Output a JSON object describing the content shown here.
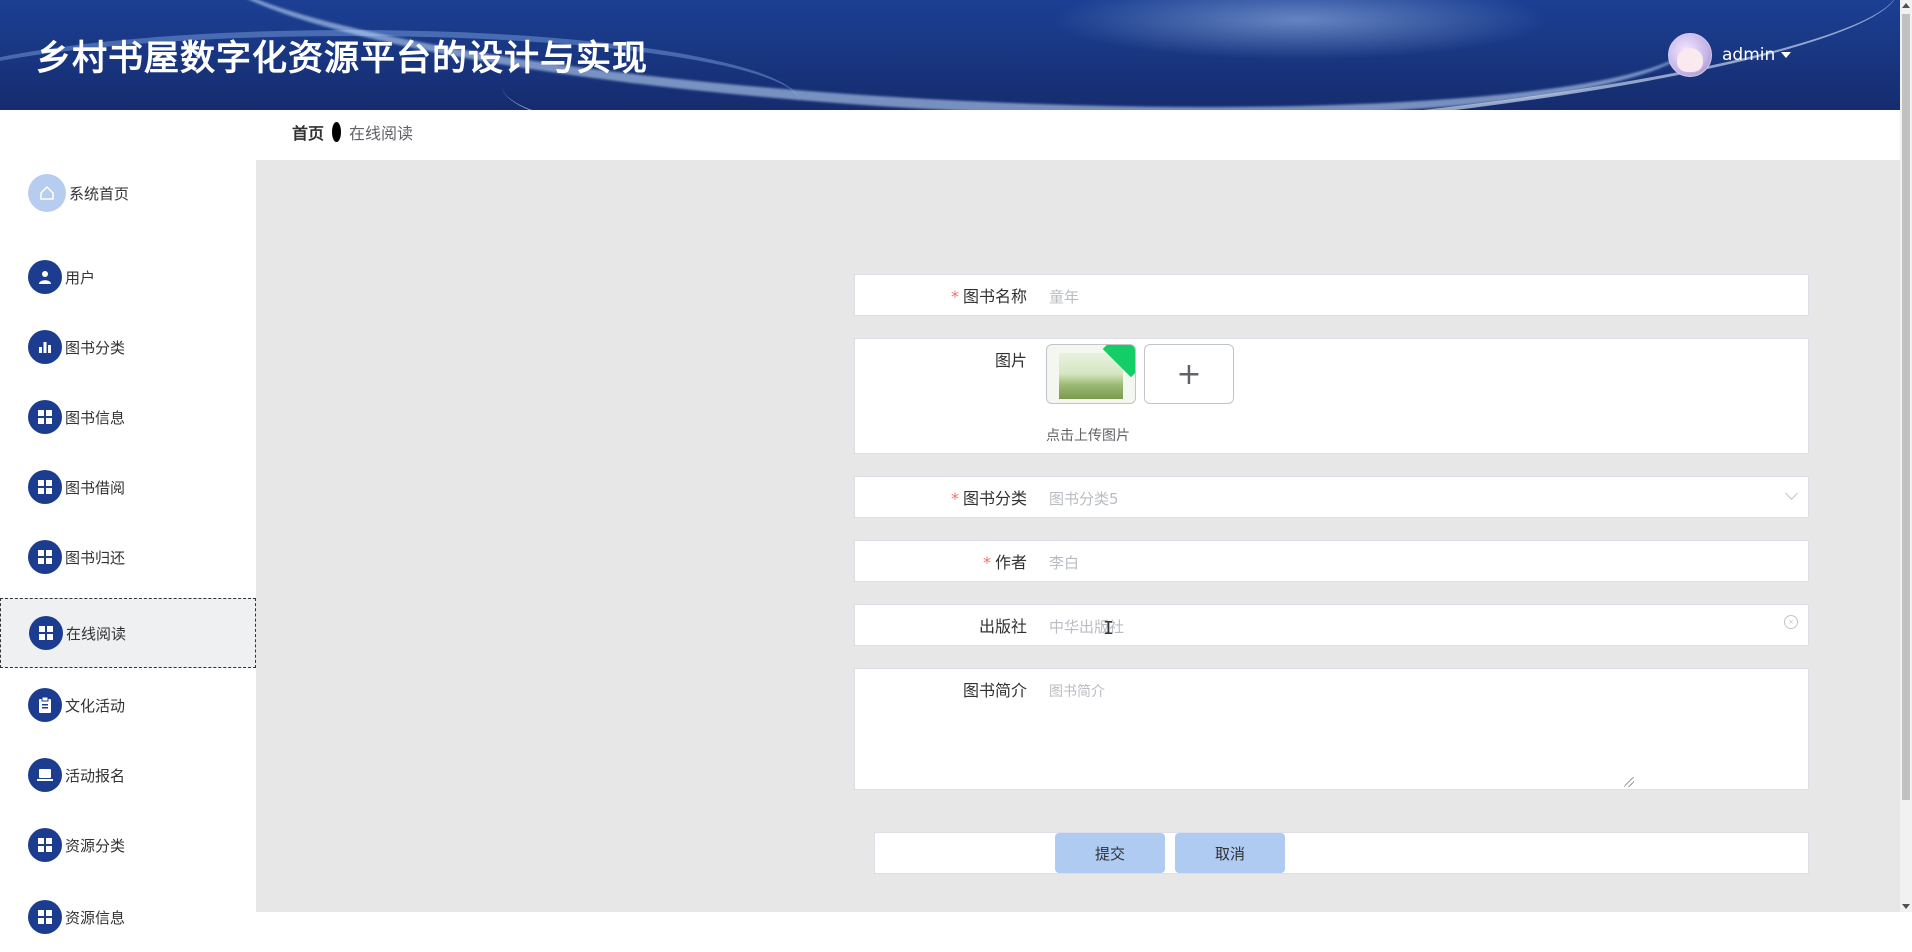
{
  "app": {
    "title": "乡村书屋数字化资源平台的设计与实现"
  },
  "user": {
    "name": "admin"
  },
  "breadcrumb": {
    "home": "首页",
    "current": "在线阅读"
  },
  "sidebar": {
    "items": [
      {
        "label": "系统首页",
        "icon": "home-icon"
      },
      {
        "label": "用户",
        "icon": "user-icon"
      },
      {
        "label": "图书分类",
        "icon": "bar-chart-icon"
      },
      {
        "label": "图书信息",
        "icon": "grid-icon"
      },
      {
        "label": "图书借阅",
        "icon": "grid-icon"
      },
      {
        "label": "图书归还",
        "icon": "grid-icon"
      },
      {
        "label": "在线阅读",
        "icon": "grid-icon",
        "active": true
      },
      {
        "label": "文化活动",
        "icon": "clipboard-icon"
      },
      {
        "label": "活动报名",
        "icon": "laptop-icon"
      },
      {
        "label": "资源分类",
        "icon": "grid-icon"
      },
      {
        "label": "资源信息",
        "icon": "grid-icon"
      }
    ]
  },
  "form": {
    "book_name": {
      "label": "图书名称",
      "required": true,
      "value": "童年"
    },
    "image": {
      "label": "图片",
      "upload_tip": "点击上传图片",
      "plus": "+"
    },
    "category": {
      "label": "图书分类",
      "required": true,
      "value": "图书分类5"
    },
    "author": {
      "label": "作者",
      "required": true,
      "value": "李白"
    },
    "publisher": {
      "label": "出版社",
      "value": "中华出版社"
    },
    "intro": {
      "label": "图书简介",
      "placeholder": "图书简介"
    },
    "required_mark": "*"
  },
  "buttons": {
    "submit": "提交",
    "cancel": "取消"
  }
}
